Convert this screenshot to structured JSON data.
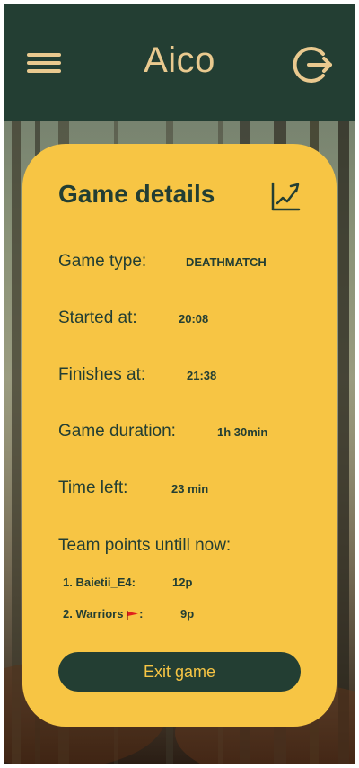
{
  "app": {
    "title": "Aico"
  },
  "card": {
    "title": "Game details",
    "rows": [
      {
        "label": "Game type:",
        "value": "DEATHMATCH"
      },
      {
        "label": "Started at:",
        "value": "20:08"
      },
      {
        "label": "Finishes at:",
        "value": "21:38"
      },
      {
        "label": "Game duration:",
        "value": "1h 30min"
      },
      {
        "label": "Time left:",
        "value": "23 min"
      }
    ],
    "team_points_title": "Team points untill now:",
    "teams": [
      {
        "rank": "1.",
        "name": "Baietii_E4",
        "suffix": ":",
        "points": "12p"
      },
      {
        "rank": "2.",
        "name": "Warriors",
        "flag": "red-flag-icon",
        "suffix": ":",
        "points": "9p"
      }
    ],
    "exit_label": "Exit game"
  },
  "colors": {
    "header": "#233e33",
    "accent": "#e9c98f",
    "card": "#f7c544",
    "text": "#233e33",
    "flag": "#e0201c"
  },
  "icons": {
    "menu": "hamburger-menu-icon",
    "logout": "logout-icon",
    "stats": "line-chart-icon"
  }
}
